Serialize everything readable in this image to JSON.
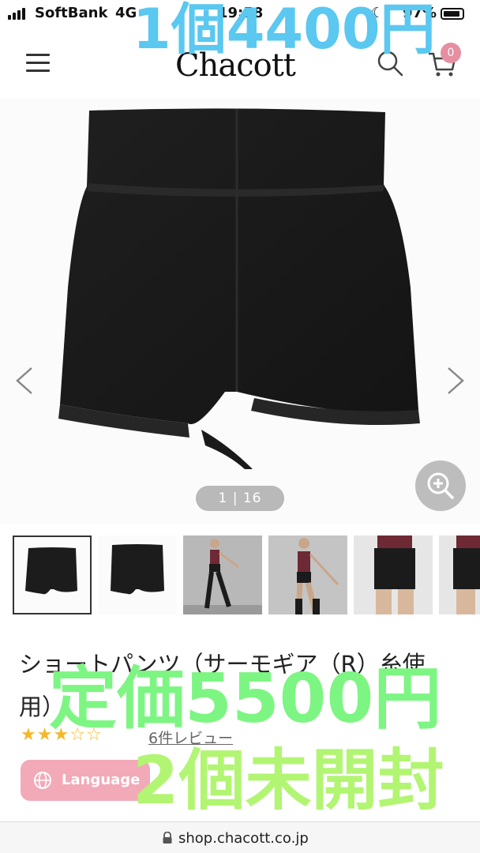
{
  "status_bar": {
    "carrier": "SoftBank",
    "network": "4G",
    "time": "19:58",
    "battery": "97%"
  },
  "header": {
    "logo": "Chacott",
    "cart_count": "0",
    "icons": [
      "menu-icon",
      "search-icon",
      "cart-icon"
    ]
  },
  "overlays": {
    "price": "1個4400円",
    "list_price": "定価5500円",
    "note": "2個未開封"
  },
  "gallery": {
    "counter": "1 | 16",
    "zoom_icon": "zoom-in-icon",
    "thumbnails": [
      "shorts-front",
      "shorts-back",
      "model-full-1",
      "model-full-2",
      "model-closeup-1",
      "model-closeup-2"
    ],
    "active_index": 0
  },
  "product": {
    "title_line1": "ショートパンツ（サーモギア（R）糸使",
    "title_line2": "用）",
    "rating": 3.5,
    "max_rating": 5,
    "reviews_link": "6件レビュー"
  },
  "language_button": {
    "label": "Language"
  },
  "address_bar": {
    "url": "shop.chacott.co.jp"
  },
  "colors": {
    "price_overlay": "#5ac8f0",
    "list_price_overlay": "#7df582",
    "note_overlay": "#b2f572",
    "accent_pink": "#f2aab8",
    "star": "#f2b92b"
  }
}
